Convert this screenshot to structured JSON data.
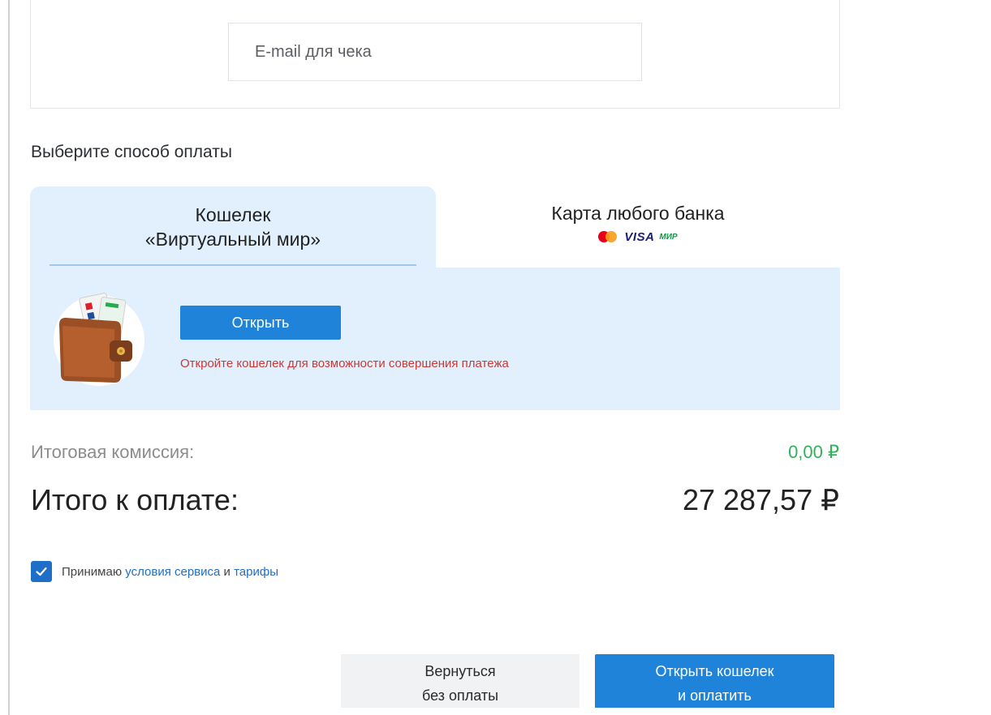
{
  "email": {
    "placeholder": "E-mail для чека"
  },
  "payment": {
    "section_title": "Выберите способ оплаты",
    "tabs": [
      {
        "line1": "Кошелек",
        "line2": "«Виртуальный мир»",
        "active": true
      },
      {
        "line1": "Карта любого банка",
        "logos": [
          "mastercard-icon",
          "VISA",
          "МИР"
        ],
        "active": false
      }
    ],
    "wallet_panel": {
      "open_label": "Открыть",
      "warning": "Откройте кошелек для возможности совершения платежа"
    }
  },
  "totals": {
    "commission_label": "Итоговая комиссия:",
    "commission_value": "0,00 ₽",
    "total_label": "Итого к оплате:",
    "total_value": "27 287,57 ₽"
  },
  "terms": {
    "checked": true,
    "prefix": "Принимаю",
    "link1": "условия сервиса",
    "middle": "и",
    "link2": "тарифы"
  },
  "actions": {
    "back_line1": "Вернуться",
    "back_line2": "без оплаты",
    "pay_line1": "Открыть кошелек",
    "pay_line2": "и оплатить"
  },
  "colors": {
    "accent": "#1f84d9",
    "panel_bg": "#e1f0fc",
    "warning": "#c73a35",
    "success": "#2fb35a"
  }
}
